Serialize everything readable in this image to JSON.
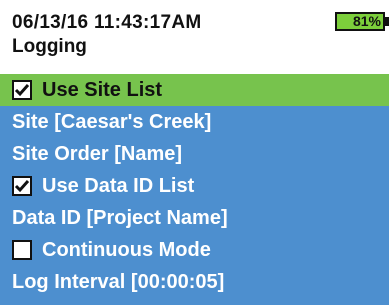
{
  "status": {
    "datetime": "06/13/16  11:43:17AM",
    "battery_percent": "81%",
    "battery_level": 0.81
  },
  "page": {
    "title": "Logging"
  },
  "menu": [
    {
      "label": "Use Site List",
      "checkbox": true,
      "checked": true,
      "selected": true
    },
    {
      "label": "Site [Caesar's Creek]",
      "checkbox": false,
      "selected": false
    },
    {
      "label": "Site Order [Name]",
      "checkbox": false,
      "selected": false
    },
    {
      "label": "Use Data ID List",
      "checkbox": true,
      "checked": true,
      "selected": false
    },
    {
      "label": "Data ID [Project Name]",
      "checkbox": false,
      "selected": false
    },
    {
      "label": "Continuous Mode",
      "checkbox": true,
      "checked": false,
      "selected": false
    },
    {
      "label": "Log Interval [00:00:05]",
      "checkbox": false,
      "selected": false
    }
  ],
  "colors": {
    "menu_background": "#4d8fcf",
    "selected_background": "#77c34d",
    "battery_fill": "#7ccf3b"
  }
}
